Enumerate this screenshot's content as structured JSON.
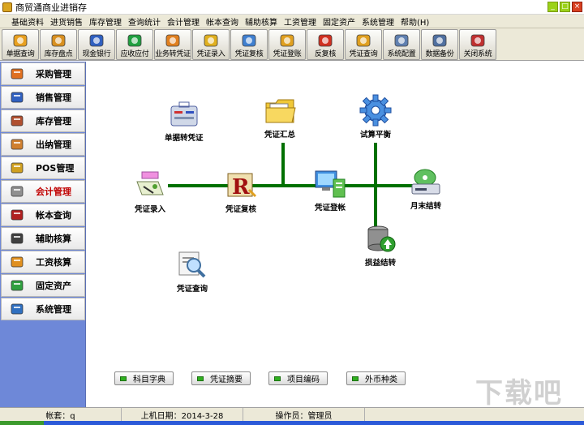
{
  "window": {
    "title": "商贸通商业进销存",
    "minimize": "_",
    "maximize": "□",
    "close": "×"
  },
  "menu": [
    "基础资料",
    "进货销售",
    "库存管理",
    "查询统计",
    "会计管理",
    "帐本查询",
    "辅助核算",
    "工资管理",
    "固定资产",
    "系统管理",
    "帮助(H)"
  ],
  "toolbar": [
    {
      "label": "单据查询",
      "icon": "search-doc-icon",
      "color": "#e8a020"
    },
    {
      "label": "库存盘点",
      "icon": "clock-icon",
      "color": "#d89020"
    },
    {
      "label": "现金银行",
      "icon": "cash-icon",
      "color": "#3060c0"
    },
    {
      "label": "应收应付",
      "icon": "checklist-icon",
      "color": "#20a040"
    },
    {
      "label": "业务转凭证",
      "icon": "convert-icon",
      "color": "#e08020"
    },
    {
      "label": "凭证录入",
      "icon": "pencil-icon",
      "color": "#e0b020"
    },
    {
      "label": "凭证复核",
      "icon": "gear-check-icon",
      "color": "#4080d0"
    },
    {
      "label": "凭证登账",
      "icon": "edit-icon",
      "color": "#e0a020"
    },
    {
      "label": "反复核",
      "icon": "stop-icon",
      "color": "#d03020"
    },
    {
      "label": "凭证查询",
      "icon": "magnifier-icon",
      "color": "#e0a020"
    },
    {
      "label": "系统配置",
      "icon": "server-icon",
      "color": "#6080b0"
    },
    {
      "label": "数据备份",
      "icon": "backup-icon",
      "color": "#5070a0"
    },
    {
      "label": "关闭系统",
      "icon": "shutdown-icon",
      "color": "#c03030"
    }
  ],
  "sidebar": [
    {
      "label": "采购管理",
      "icon": "cart-icon",
      "color": "#e07020",
      "active": false
    },
    {
      "label": "销售管理",
      "icon": "pen-icon",
      "color": "#3060c0",
      "active": false
    },
    {
      "label": "库存管理",
      "icon": "house-icon",
      "color": "#b05030",
      "active": false
    },
    {
      "label": "出纳管理",
      "icon": "safe-icon",
      "color": "#d08030",
      "active": false
    },
    {
      "label": "POS管理",
      "icon": "coins-icon",
      "color": "#d0a020",
      "active": false
    },
    {
      "label": "会计管理",
      "icon": "ledger-icon",
      "color": "#909090",
      "active": true
    },
    {
      "label": "帐本查询",
      "icon": "book-icon",
      "color": "#b02020",
      "active": false
    },
    {
      "label": "辅助核算",
      "icon": "calculator-icon",
      "color": "#404040",
      "active": false
    },
    {
      "label": "工资核算",
      "icon": "folder-pen-icon",
      "color": "#e09020",
      "active": false
    },
    {
      "label": "固定资产",
      "icon": "assets-icon",
      "color": "#30a040",
      "active": false
    },
    {
      "label": "系统管理",
      "icon": "system-icon",
      "color": "#3070c0",
      "active": false
    }
  ],
  "flow": {
    "line_color": "#007000",
    "nodes": {
      "voucher_entry": "凭证录入",
      "voucher_review": "凭证复核",
      "voucher_posting": "凭证登帐",
      "month_end": "月末结转",
      "doc_to_voucher": "单据转凭证",
      "voucher_summary": "凭证汇总",
      "trial_balance": "试算平衡",
      "profit_loss": "损益结转",
      "voucher_query": "凭证查询"
    }
  },
  "bottom_buttons": [
    "科目字典",
    "凭证摘要",
    "项目编码",
    "外币种类"
  ],
  "status": {
    "account": "帐套：q",
    "login_date": "上机日期：2014-3-28",
    "operator": "操作员：管理员"
  },
  "watermark": "下载吧"
}
